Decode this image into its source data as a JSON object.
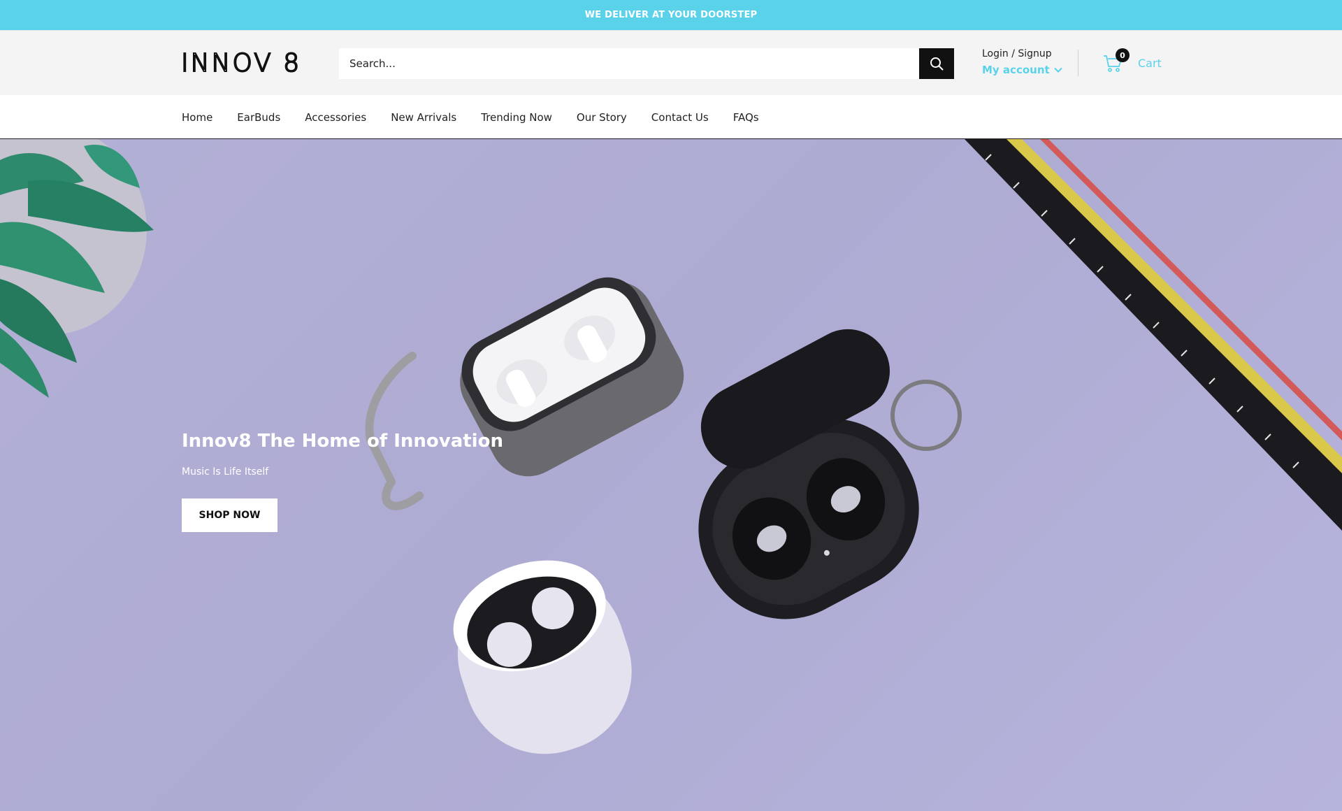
{
  "announcement": {
    "text": "WE DELIVER AT YOUR DOORSTEP"
  },
  "header": {
    "logo_text": "INNOV 8",
    "search": {
      "placeholder": "Search...",
      "value": ""
    },
    "account": {
      "login_label": "Login / Signup",
      "my_account_label": "My account"
    },
    "cart": {
      "label": "Cart",
      "count": "0"
    }
  },
  "nav": {
    "items": [
      {
        "label": "Home"
      },
      {
        "label": "EarBuds"
      },
      {
        "label": "Accessories"
      },
      {
        "label": "New Arrivals"
      },
      {
        "label": "Trending Now"
      },
      {
        "label": "Our Story"
      },
      {
        "label": "Contact Us"
      },
      {
        "label": "FAQs"
      }
    ]
  },
  "hero": {
    "title": "Innov8 The Home of Innovation",
    "subtitle": "Music Is Life Itself",
    "cta_label": "SHOP NOW"
  },
  "colors": {
    "accent": "#5ad2ea",
    "dark": "#111111",
    "hero_bg": "#b3b0d6"
  },
  "icons": {
    "search": "search-icon",
    "cart": "cart-icon",
    "dropdown": "chevron-down-icon"
  }
}
